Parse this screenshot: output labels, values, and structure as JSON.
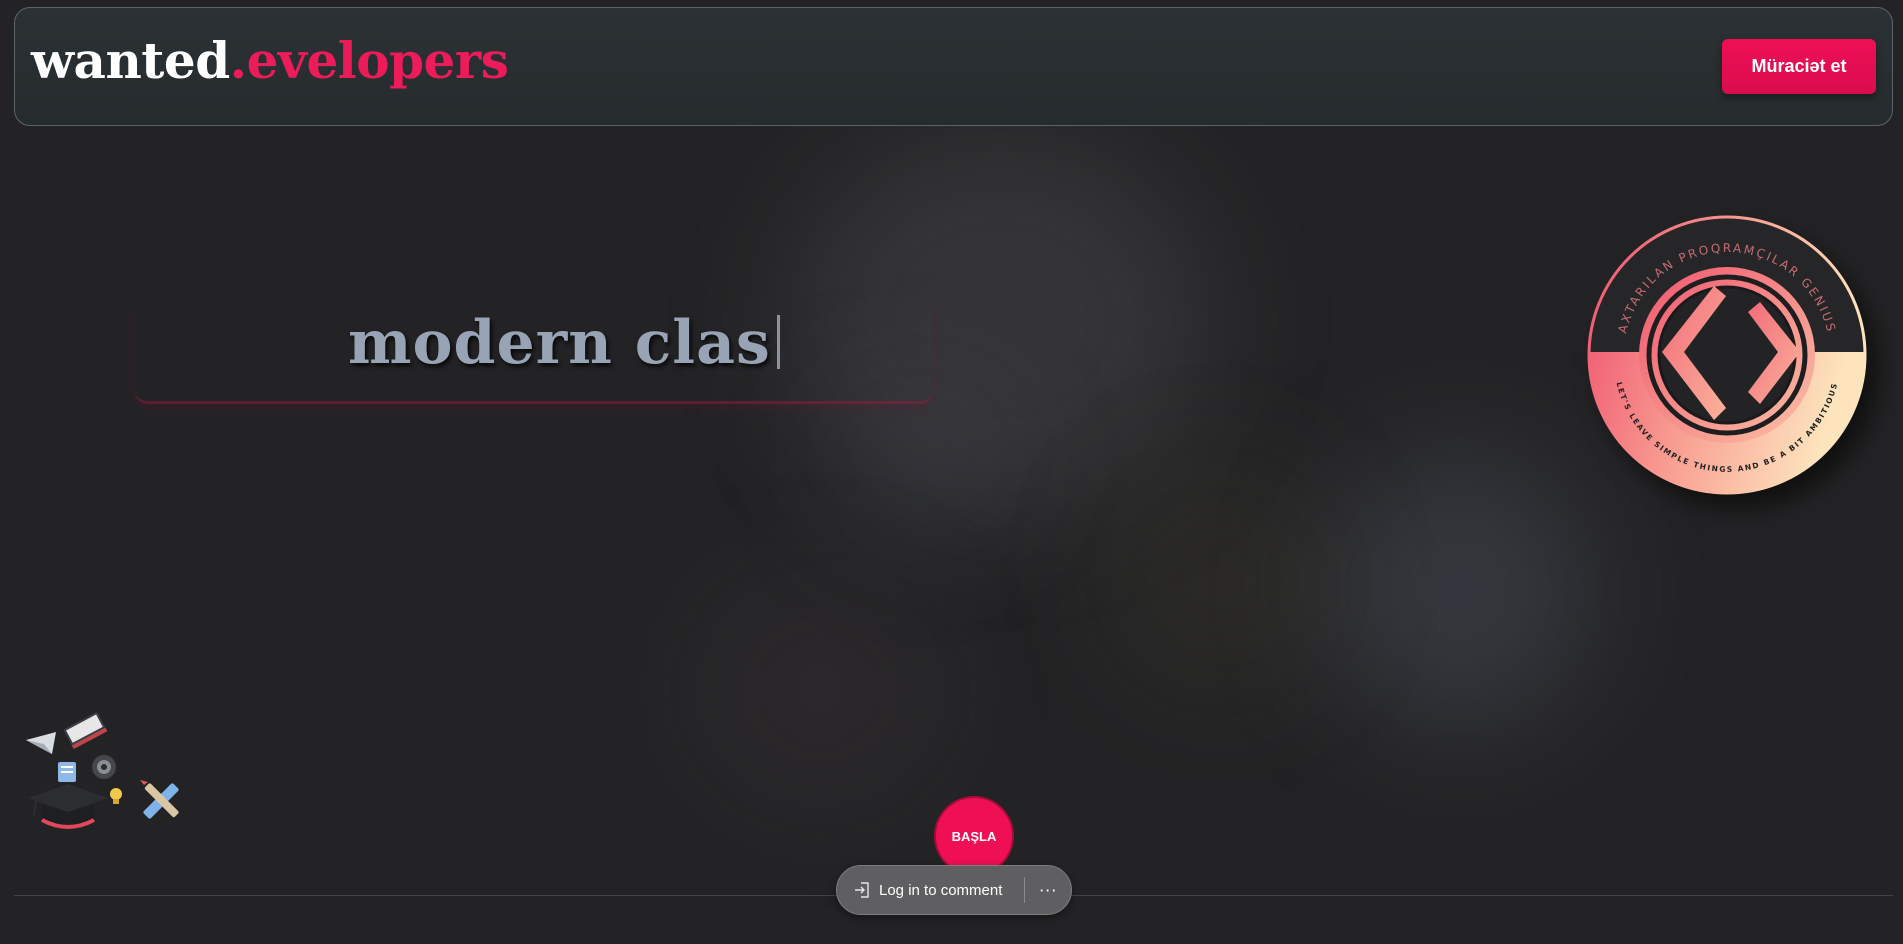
{
  "header": {
    "logo_primary": "wanted",
    "logo_accent": ".evelopers",
    "apply_label": "Müraciət et"
  },
  "hero": {
    "typing_text": "modern clas"
  },
  "badge": {
    "arc_top": "AXTARILAN PROQRAMÇILAR GENIUS",
    "arc_bottom": "LET'S LEAVE SIMPLE THINGS AND BE A BIT AMBITIOUS",
    "icon": "code-brackets-icon"
  },
  "start": {
    "label": "BAŞLA"
  },
  "comment_bar": {
    "login_label": "Log in to comment",
    "more_label": "···"
  },
  "colors": {
    "accent": "#ec1b5a",
    "background": "#232325",
    "header_bg": "#282e31",
    "typing_text": "#98a3b5"
  }
}
